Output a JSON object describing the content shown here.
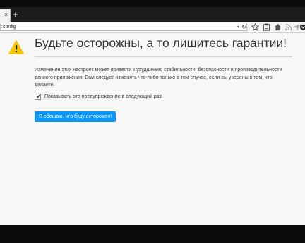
{
  "browser": {
    "tab_close": "×",
    "new_tab": "+",
    "url": ":config",
    "icons": [
      "dropdown-icon",
      "reload-icon",
      "bookmark-star-icon",
      "reading-list-icon",
      "home-icon",
      "rss-icon",
      "send-icon",
      "pocket-icon"
    ]
  },
  "page": {
    "title": "Будьте осторожны, а то лишитесь гарантии!",
    "description": "Изменение этих настроек может привести к ухудшению стабильности, безопасности и производительности данного приложения. Вам следует изменять что-либо только в том случае, если вы уверены в том, что делаете.",
    "checkbox_checked": true,
    "checkbox_label": "Показывать это предупреждение в следующий раз",
    "button_label": "Я обещаю, что буду осторожен!",
    "warning_color": "#f5c400",
    "accent_color": "#0996f8"
  }
}
